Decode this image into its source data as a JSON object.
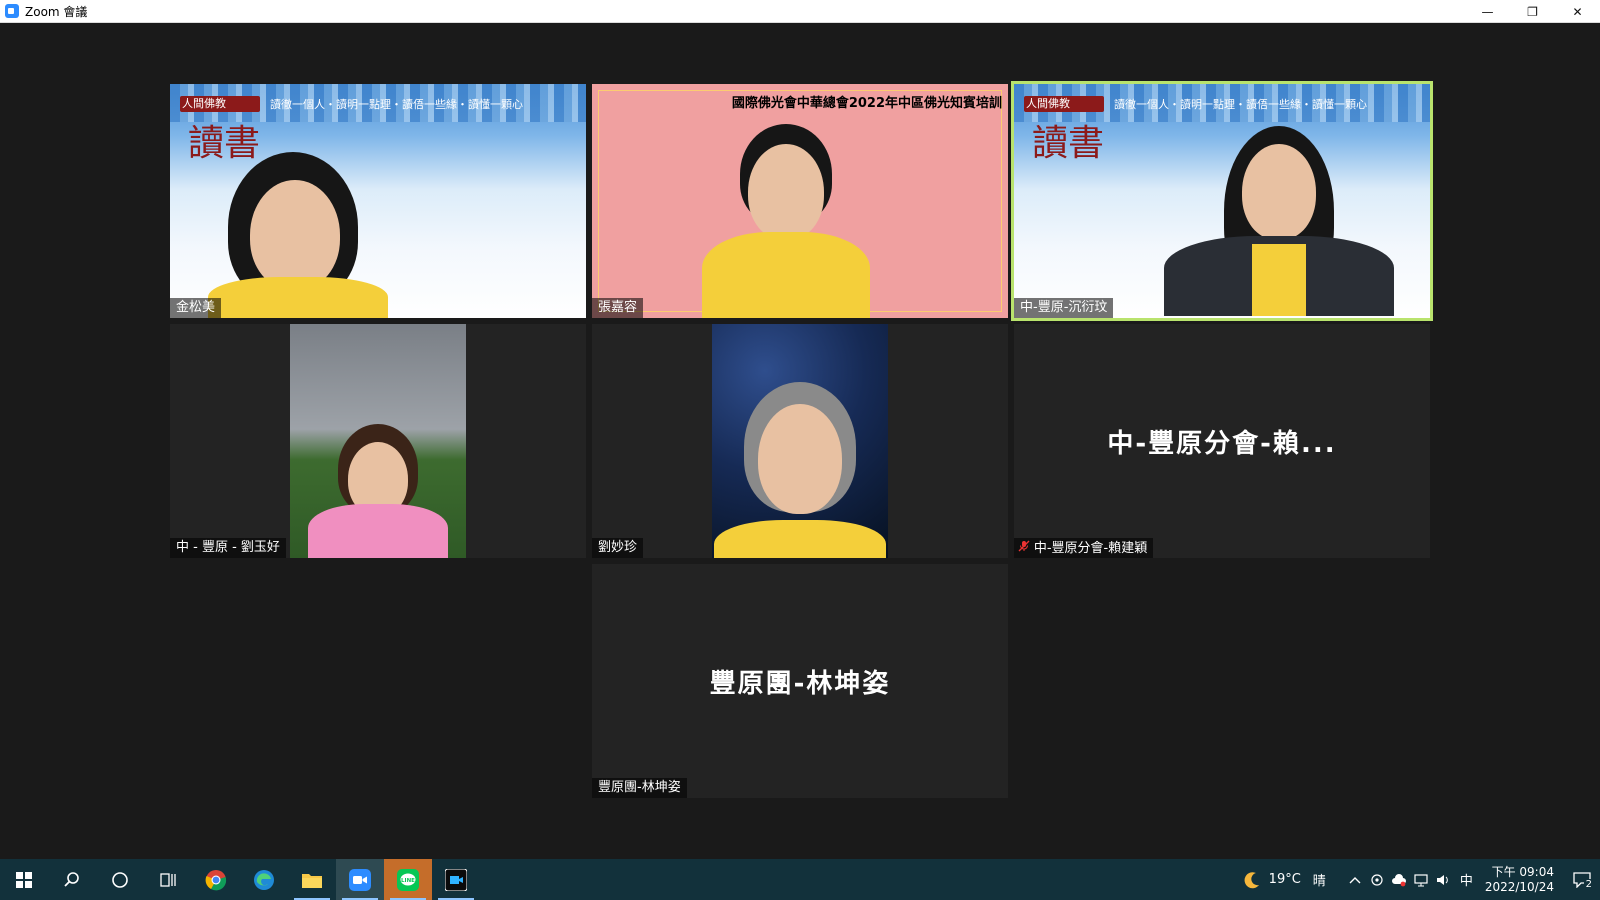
{
  "window": {
    "title": "Zoom 會議",
    "controls": {
      "minimize": "—",
      "restore": "❐",
      "close": "✕"
    }
  },
  "participants": [
    {
      "name": "金松美",
      "mode": "video",
      "background": "sky",
      "banner": "人間佛教",
      "slogan": "讀徹一個人・讀明一點理・讀俉一些緣・讀懂一顆心",
      "calligraphy": "讀書"
    },
    {
      "name": "張嘉容",
      "mode": "video",
      "background": "pink",
      "header": "國際佛光會中華總會2022年中區佛光知賓培訓"
    },
    {
      "name": "中-豐原-沉衍玟",
      "mode": "video",
      "background": "sky",
      "active_speaker": true,
      "banner": "人間佛教",
      "slogan": "讀徹一個人・讀明一點理・讀俉一些緣・讀懂一顆心",
      "calligraphy": "讀書"
    },
    {
      "name": "中 - 豐原 - 劉玉好",
      "mode": "video",
      "background": "field"
    },
    {
      "name": "劉妙珍",
      "mode": "video",
      "background": "space"
    },
    {
      "name": "中-豐原分會-賴建穎",
      "mode": "avatar",
      "big_name": "中-豐原分會-賴...",
      "muted": true
    },
    {
      "name": "豐原團-林坤姿",
      "mode": "avatar",
      "big_name": "豐原團-林坤姿"
    }
  ],
  "taskbar": {
    "apps": [
      "start-icon",
      "search-icon",
      "cortana-icon",
      "task-view-icon",
      "chrome-icon",
      "edge-icon",
      "file-explorer-icon",
      "zoom-icon",
      "line-icon",
      "video-app-icon"
    ],
    "weather": {
      "temp": "19°C",
      "condition": "晴"
    },
    "ime": "中",
    "time": "下午 09:04",
    "date": "2022/10/24",
    "notification_count": "2"
  },
  "colors": {
    "active_outline": "#b9e36d",
    "taskbar_bg": "#12313b",
    "meeting_bg": "#1a1a1a",
    "tile_bg": "#232323"
  }
}
